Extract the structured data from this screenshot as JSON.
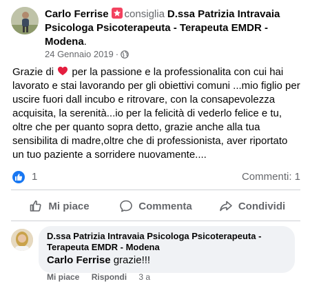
{
  "post": {
    "author": "Carlo Ferrise",
    "recommends_label": "consiglia",
    "page_name": "D.ssa Patrizia Intravaia Psicologa Psicoterapeuta - Terapeuta EMDR - Modena",
    "date": "24 Gennaio 2019",
    "separator": "·",
    "privacy_icon": "globe-icon",
    "text_before_heart": "Grazie di",
    "text_after_heart": " per la passione e la professionalita con cui hai lavorato e stai lavorando per gli obiettivi comuni ...mio figlio per uscire fuori dall incubo e ritrovare, con la consapevolezza acquisita, la serenità...io per la felicità di vederlo  felice e tu, oltre che per quanto sopra detto, grazie anche alla tua sensibilita di madre,oltre che di professionista, aver riportato un tuo paziente a sorridere nuovamente....",
    "heart_color": "#e41e3f"
  },
  "stats": {
    "like_count": "1",
    "comments": "Commenti: 1",
    "like_color": "#1877f2"
  },
  "actions": {
    "like": "Mi piace",
    "comment": "Commenta",
    "share": "Condividi"
  },
  "comment": {
    "author": "D.ssa Patrizia Intravaia Psicologa Psicoterapeuta - Terapeuta EMDR - Modena",
    "mention": "Carlo Ferrise",
    "text": " grazie!!!",
    "like_label": "Mi piace",
    "reply_label": "Rispondi",
    "time": "3 a"
  },
  "colors": {
    "secondary_text": "#65676b",
    "recommend_badge": "#f3425f",
    "bubble_bg": "#f0f2f5"
  }
}
